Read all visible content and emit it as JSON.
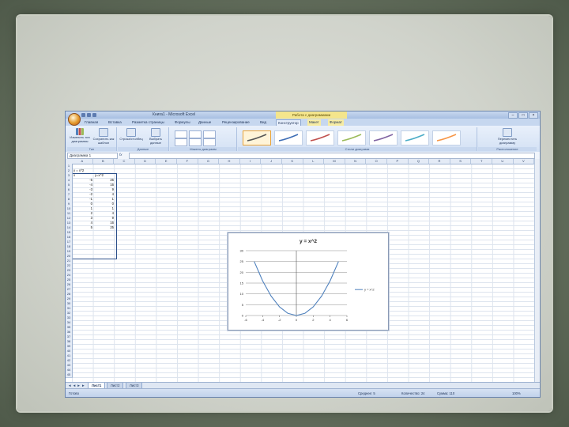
{
  "window": {
    "title": "Книга1 - Microsoft Excel",
    "context_title": "Работа с диаграммами",
    "controls": [
      "–",
      "□",
      "×"
    ]
  },
  "ribbon": {
    "tabs": [
      "Главная",
      "Вставка",
      "Разметка страницы",
      "Формулы",
      "Данные",
      "Рецензирование",
      "Вид",
      "Конструктор",
      "Макет",
      "Формат"
    ],
    "active_tab": "Конструктор",
    "groups": {
      "type": {
        "label": "Тип",
        "buttons": [
          "Изменить тип диаграммы",
          "Сохранить как шаблон"
        ]
      },
      "data": {
        "label": "Данные",
        "buttons": [
          "Строка/столбец",
          "Выбрать данные"
        ]
      },
      "layouts": {
        "label": "Макеты диаграмм"
      },
      "styles": {
        "label": "Стили диаграмм",
        "swatch_colors": [
          "#555555",
          "#3d6db5",
          "#c0504d",
          "#9bbb59",
          "#8064a2",
          "#4bacc6",
          "#f79646"
        ]
      },
      "location": {
        "label": "Расположение",
        "buttons": [
          "Переместить диаграмму"
        ]
      }
    }
  },
  "formula_bar": {
    "name_box": "Диаграмма 1",
    "fx": "fx",
    "content": ""
  },
  "columns": [
    "A",
    "B",
    "C",
    "D",
    "E",
    "F",
    "G",
    "H",
    "I",
    "J",
    "K",
    "L",
    "M",
    "N",
    "O",
    "P",
    "Q",
    "R",
    "S",
    "T",
    "U",
    "V"
  ],
  "rows": [
    "1",
    "2",
    "3",
    "4",
    "5",
    "6",
    "7",
    "8",
    "9",
    "10",
    "11",
    "12",
    "13",
    "14",
    "15",
    "16",
    "17",
    "18",
    "19",
    "20",
    "21",
    "22",
    "23",
    "24",
    "25",
    "26",
    "27",
    "28",
    "29",
    "30",
    "31",
    "32",
    "33",
    "34",
    "35",
    "36",
    "37",
    "38",
    "39",
    "40",
    "41",
    "42",
    "43",
    "44",
    "45"
  ],
  "cells": {
    "a1": "y = x^2",
    "a2": "x",
    "b2": "y=x^2",
    "x_values": [
      "-5",
      "-4",
      "-3",
      "-2",
      "-1",
      "0",
      "1",
      "2",
      "3",
      "4",
      "5"
    ],
    "y_values": [
      "25",
      "16",
      "9",
      "4",
      "1",
      "0",
      "1",
      "4",
      "9",
      "16",
      "25"
    ]
  },
  "sheets": [
    "Лист1",
    "Лист2",
    "Лист3"
  ],
  "active_sheet": "Лист1",
  "status_bar": {
    "left": "Готово",
    "average": "Среднее: 5",
    "count": "Количество: 24",
    "sum": "Сумма: 110",
    "zoom": "100%"
  },
  "chart_data": {
    "type": "line",
    "title": "y = x^2",
    "x": [
      -5,
      -4,
      -3,
      -2,
      -1,
      0,
      1,
      2,
      3,
      4,
      5
    ],
    "series": [
      {
        "name": "y = x^2",
        "values": [
          25,
          16,
          9,
          4,
          1,
          0,
          1,
          4,
          9,
          16,
          25
        ],
        "color": "#4f81bd"
      }
    ],
    "x_ticks": [
      "-6",
      "-4",
      "-2",
      "0",
      "2",
      "4",
      "6"
    ],
    "y_ticks": [
      "0",
      "5",
      "10",
      "15",
      "20",
      "25",
      "30"
    ],
    "xlim": [
      -6,
      6
    ],
    "ylim": [
      0,
      30
    ],
    "grid": true,
    "legend_position": "right"
  }
}
